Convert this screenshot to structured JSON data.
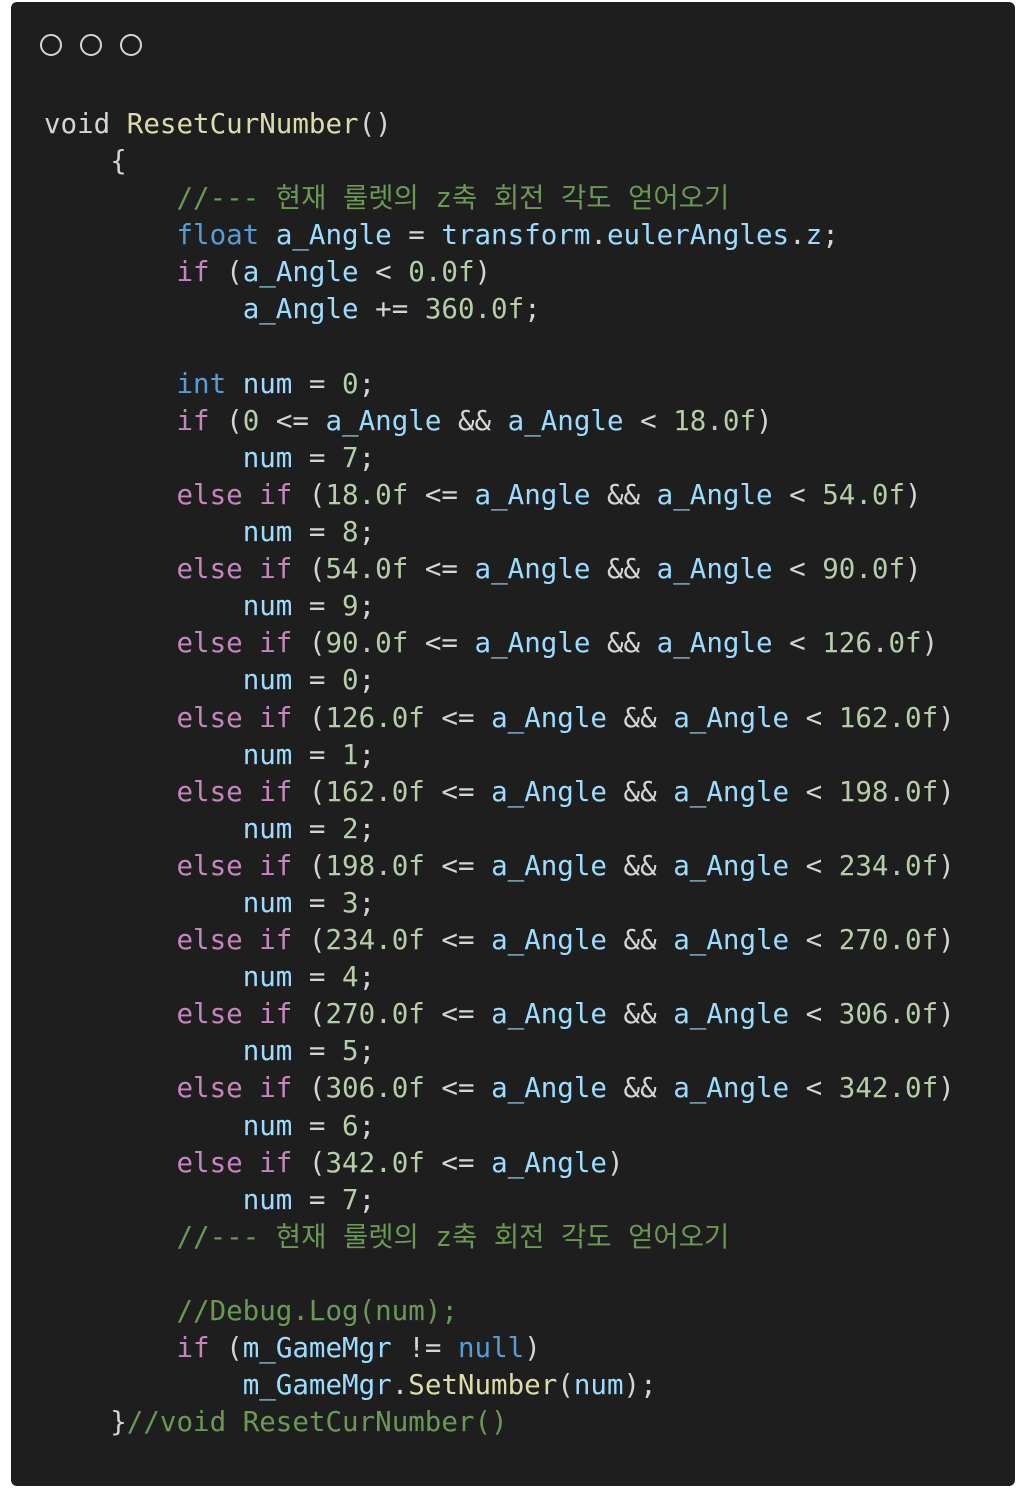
{
  "window": {
    "controls": [
      "close",
      "minimize",
      "maximize"
    ]
  },
  "theme": {
    "background": "#1e1e1e",
    "text": "#d4d4d4",
    "keyword": "#569cd6",
    "control": "#c586c0",
    "identifier": "#9cdcfe",
    "function": "#dcdcaa",
    "number": "#b5cea8",
    "comment": "#6a9955"
  },
  "code_lines": [
    [
      [
        "pl",
        "void "
      ],
      [
        "fn",
        "ResetCurNumber"
      ],
      [
        "pl",
        "()"
      ]
    ],
    [
      [
        "pl",
        "    {"
      ]
    ],
    [
      [
        "pl",
        "        "
      ],
      [
        "cmt",
        "//--- 현재 룰렛의 z축 회전 각도 얻어오기"
      ]
    ],
    [
      [
        "pl",
        "        "
      ],
      [
        "kw",
        "float"
      ],
      [
        "pl",
        " "
      ],
      [
        "id",
        "a_Angle"
      ],
      [
        "pl",
        " = "
      ],
      [
        "id",
        "transform"
      ],
      [
        "pl",
        "."
      ],
      [
        "id",
        "eulerAngles"
      ],
      [
        "pl",
        "."
      ],
      [
        "id",
        "z"
      ],
      [
        "pl",
        ";"
      ]
    ],
    [
      [
        "pl",
        "        "
      ],
      [
        "ctl",
        "if"
      ],
      [
        "pl",
        " ("
      ],
      [
        "id",
        "a_Angle"
      ],
      [
        "pl",
        " < "
      ],
      [
        "num",
        "0.0f"
      ],
      [
        "pl",
        ")"
      ]
    ],
    [
      [
        "pl",
        "            "
      ],
      [
        "id",
        "a_Angle"
      ],
      [
        "pl",
        " += "
      ],
      [
        "num",
        "360.0f"
      ],
      [
        "pl",
        ";"
      ]
    ],
    [],
    [
      [
        "pl",
        "        "
      ],
      [
        "kw",
        "int"
      ],
      [
        "pl",
        " "
      ],
      [
        "id",
        "num"
      ],
      [
        "pl",
        " = "
      ],
      [
        "num",
        "0"
      ],
      [
        "pl",
        ";"
      ]
    ],
    [
      [
        "pl",
        "        "
      ],
      [
        "ctl",
        "if"
      ],
      [
        "pl",
        " ("
      ],
      [
        "num",
        "0"
      ],
      [
        "pl",
        " <= "
      ],
      [
        "id",
        "a_Angle"
      ],
      [
        "pl",
        " && "
      ],
      [
        "id",
        "a_Angle"
      ],
      [
        "pl",
        " < "
      ],
      [
        "num",
        "18.0f"
      ],
      [
        "pl",
        ")"
      ]
    ],
    [
      [
        "pl",
        "            "
      ],
      [
        "id",
        "num"
      ],
      [
        "pl",
        " = "
      ],
      [
        "num",
        "7"
      ],
      [
        "pl",
        ";"
      ]
    ],
    [
      [
        "pl",
        "        "
      ],
      [
        "ctl",
        "else"
      ],
      [
        "pl",
        " "
      ],
      [
        "ctl",
        "if"
      ],
      [
        "pl",
        " ("
      ],
      [
        "num",
        "18.0f"
      ],
      [
        "pl",
        " <= "
      ],
      [
        "id",
        "a_Angle"
      ],
      [
        "pl",
        " && "
      ],
      [
        "id",
        "a_Angle"
      ],
      [
        "pl",
        " < "
      ],
      [
        "num",
        "54.0f"
      ],
      [
        "pl",
        ")"
      ]
    ],
    [
      [
        "pl",
        "            "
      ],
      [
        "id",
        "num"
      ],
      [
        "pl",
        " = "
      ],
      [
        "num",
        "8"
      ],
      [
        "pl",
        ";"
      ]
    ],
    [
      [
        "pl",
        "        "
      ],
      [
        "ctl",
        "else"
      ],
      [
        "pl",
        " "
      ],
      [
        "ctl",
        "if"
      ],
      [
        "pl",
        " ("
      ],
      [
        "num",
        "54.0f"
      ],
      [
        "pl",
        " <= "
      ],
      [
        "id",
        "a_Angle"
      ],
      [
        "pl",
        " && "
      ],
      [
        "id",
        "a_Angle"
      ],
      [
        "pl",
        " < "
      ],
      [
        "num",
        "90.0f"
      ],
      [
        "pl",
        ")"
      ]
    ],
    [
      [
        "pl",
        "            "
      ],
      [
        "id",
        "num"
      ],
      [
        "pl",
        " = "
      ],
      [
        "num",
        "9"
      ],
      [
        "pl",
        ";"
      ]
    ],
    [
      [
        "pl",
        "        "
      ],
      [
        "ctl",
        "else"
      ],
      [
        "pl",
        " "
      ],
      [
        "ctl",
        "if"
      ],
      [
        "pl",
        " ("
      ],
      [
        "num",
        "90.0f"
      ],
      [
        "pl",
        " <= "
      ],
      [
        "id",
        "a_Angle"
      ],
      [
        "pl",
        " && "
      ],
      [
        "id",
        "a_Angle"
      ],
      [
        "pl",
        " < "
      ],
      [
        "num",
        "126.0f"
      ],
      [
        "pl",
        ")"
      ]
    ],
    [
      [
        "pl",
        "            "
      ],
      [
        "id",
        "num"
      ],
      [
        "pl",
        " = "
      ],
      [
        "num",
        "0"
      ],
      [
        "pl",
        ";"
      ]
    ],
    [
      [
        "pl",
        "        "
      ],
      [
        "ctl",
        "else"
      ],
      [
        "pl",
        " "
      ],
      [
        "ctl",
        "if"
      ],
      [
        "pl",
        " ("
      ],
      [
        "num",
        "126.0f"
      ],
      [
        "pl",
        " <= "
      ],
      [
        "id",
        "a_Angle"
      ],
      [
        "pl",
        " && "
      ],
      [
        "id",
        "a_Angle"
      ],
      [
        "pl",
        " < "
      ],
      [
        "num",
        "162.0f"
      ],
      [
        "pl",
        ")"
      ]
    ],
    [
      [
        "pl",
        "            "
      ],
      [
        "id",
        "num"
      ],
      [
        "pl",
        " = "
      ],
      [
        "num",
        "1"
      ],
      [
        "pl",
        ";"
      ]
    ],
    [
      [
        "pl",
        "        "
      ],
      [
        "ctl",
        "else"
      ],
      [
        "pl",
        " "
      ],
      [
        "ctl",
        "if"
      ],
      [
        "pl",
        " ("
      ],
      [
        "num",
        "162.0f"
      ],
      [
        "pl",
        " <= "
      ],
      [
        "id",
        "a_Angle"
      ],
      [
        "pl",
        " && "
      ],
      [
        "id",
        "a_Angle"
      ],
      [
        "pl",
        " < "
      ],
      [
        "num",
        "198.0f"
      ],
      [
        "pl",
        ")"
      ]
    ],
    [
      [
        "pl",
        "            "
      ],
      [
        "id",
        "num"
      ],
      [
        "pl",
        " = "
      ],
      [
        "num",
        "2"
      ],
      [
        "pl",
        ";"
      ]
    ],
    [
      [
        "pl",
        "        "
      ],
      [
        "ctl",
        "else"
      ],
      [
        "pl",
        " "
      ],
      [
        "ctl",
        "if"
      ],
      [
        "pl",
        " ("
      ],
      [
        "num",
        "198.0f"
      ],
      [
        "pl",
        " <= "
      ],
      [
        "id",
        "a_Angle"
      ],
      [
        "pl",
        " && "
      ],
      [
        "id",
        "a_Angle"
      ],
      [
        "pl",
        " < "
      ],
      [
        "num",
        "234.0f"
      ],
      [
        "pl",
        ")"
      ]
    ],
    [
      [
        "pl",
        "            "
      ],
      [
        "id",
        "num"
      ],
      [
        "pl",
        " = "
      ],
      [
        "num",
        "3"
      ],
      [
        "pl",
        ";"
      ]
    ],
    [
      [
        "pl",
        "        "
      ],
      [
        "ctl",
        "else"
      ],
      [
        "pl",
        " "
      ],
      [
        "ctl",
        "if"
      ],
      [
        "pl",
        " ("
      ],
      [
        "num",
        "234.0f"
      ],
      [
        "pl",
        " <= "
      ],
      [
        "id",
        "a_Angle"
      ],
      [
        "pl",
        " && "
      ],
      [
        "id",
        "a_Angle"
      ],
      [
        "pl",
        " < "
      ],
      [
        "num",
        "270.0f"
      ],
      [
        "pl",
        ")"
      ]
    ],
    [
      [
        "pl",
        "            "
      ],
      [
        "id",
        "num"
      ],
      [
        "pl",
        " = "
      ],
      [
        "num",
        "4"
      ],
      [
        "pl",
        ";"
      ]
    ],
    [
      [
        "pl",
        "        "
      ],
      [
        "ctl",
        "else"
      ],
      [
        "pl",
        " "
      ],
      [
        "ctl",
        "if"
      ],
      [
        "pl",
        " ("
      ],
      [
        "num",
        "270.0f"
      ],
      [
        "pl",
        " <= "
      ],
      [
        "id",
        "a_Angle"
      ],
      [
        "pl",
        " && "
      ],
      [
        "id",
        "a_Angle"
      ],
      [
        "pl",
        " < "
      ],
      [
        "num",
        "306.0f"
      ],
      [
        "pl",
        ")"
      ]
    ],
    [
      [
        "pl",
        "            "
      ],
      [
        "id",
        "num"
      ],
      [
        "pl",
        " = "
      ],
      [
        "num",
        "5"
      ],
      [
        "pl",
        ";"
      ]
    ],
    [
      [
        "pl",
        "        "
      ],
      [
        "ctl",
        "else"
      ],
      [
        "pl",
        " "
      ],
      [
        "ctl",
        "if"
      ],
      [
        "pl",
        " ("
      ],
      [
        "num",
        "306.0f"
      ],
      [
        "pl",
        " <= "
      ],
      [
        "id",
        "a_Angle"
      ],
      [
        "pl",
        " && "
      ],
      [
        "id",
        "a_Angle"
      ],
      [
        "pl",
        " < "
      ],
      [
        "num",
        "342.0f"
      ],
      [
        "pl",
        ")"
      ]
    ],
    [
      [
        "pl",
        "            "
      ],
      [
        "id",
        "num"
      ],
      [
        "pl",
        " = "
      ],
      [
        "num",
        "6"
      ],
      [
        "pl",
        ";"
      ]
    ],
    [
      [
        "pl",
        "        "
      ],
      [
        "ctl",
        "else"
      ],
      [
        "pl",
        " "
      ],
      [
        "ctl",
        "if"
      ],
      [
        "pl",
        " ("
      ],
      [
        "num",
        "342.0f"
      ],
      [
        "pl",
        " <= "
      ],
      [
        "id",
        "a_Angle"
      ],
      [
        "pl",
        ")"
      ]
    ],
    [
      [
        "pl",
        "            "
      ],
      [
        "id",
        "num"
      ],
      [
        "pl",
        " = "
      ],
      [
        "num",
        "7"
      ],
      [
        "pl",
        ";"
      ]
    ],
    [
      [
        "pl",
        "        "
      ],
      [
        "cmt",
        "//--- 현재 룰렛의 z축 회전 각도 얻어오기"
      ]
    ],
    [],
    [
      [
        "pl",
        "        "
      ],
      [
        "cmt",
        "//Debug.Log(num);"
      ]
    ],
    [
      [
        "pl",
        "        "
      ],
      [
        "ctl",
        "if"
      ],
      [
        "pl",
        " ("
      ],
      [
        "id",
        "m_GameMgr"
      ],
      [
        "pl",
        " != "
      ],
      [
        "kw",
        "null"
      ],
      [
        "pl",
        ")"
      ]
    ],
    [
      [
        "pl",
        "            "
      ],
      [
        "id",
        "m_GameMgr"
      ],
      [
        "pl",
        "."
      ],
      [
        "fn",
        "SetNumber"
      ],
      [
        "pl",
        "("
      ],
      [
        "id",
        "num"
      ],
      [
        "pl",
        ");"
      ]
    ],
    [
      [
        "pl",
        "    }"
      ],
      [
        "cmt",
        "//void ResetCurNumber()"
      ]
    ]
  ]
}
